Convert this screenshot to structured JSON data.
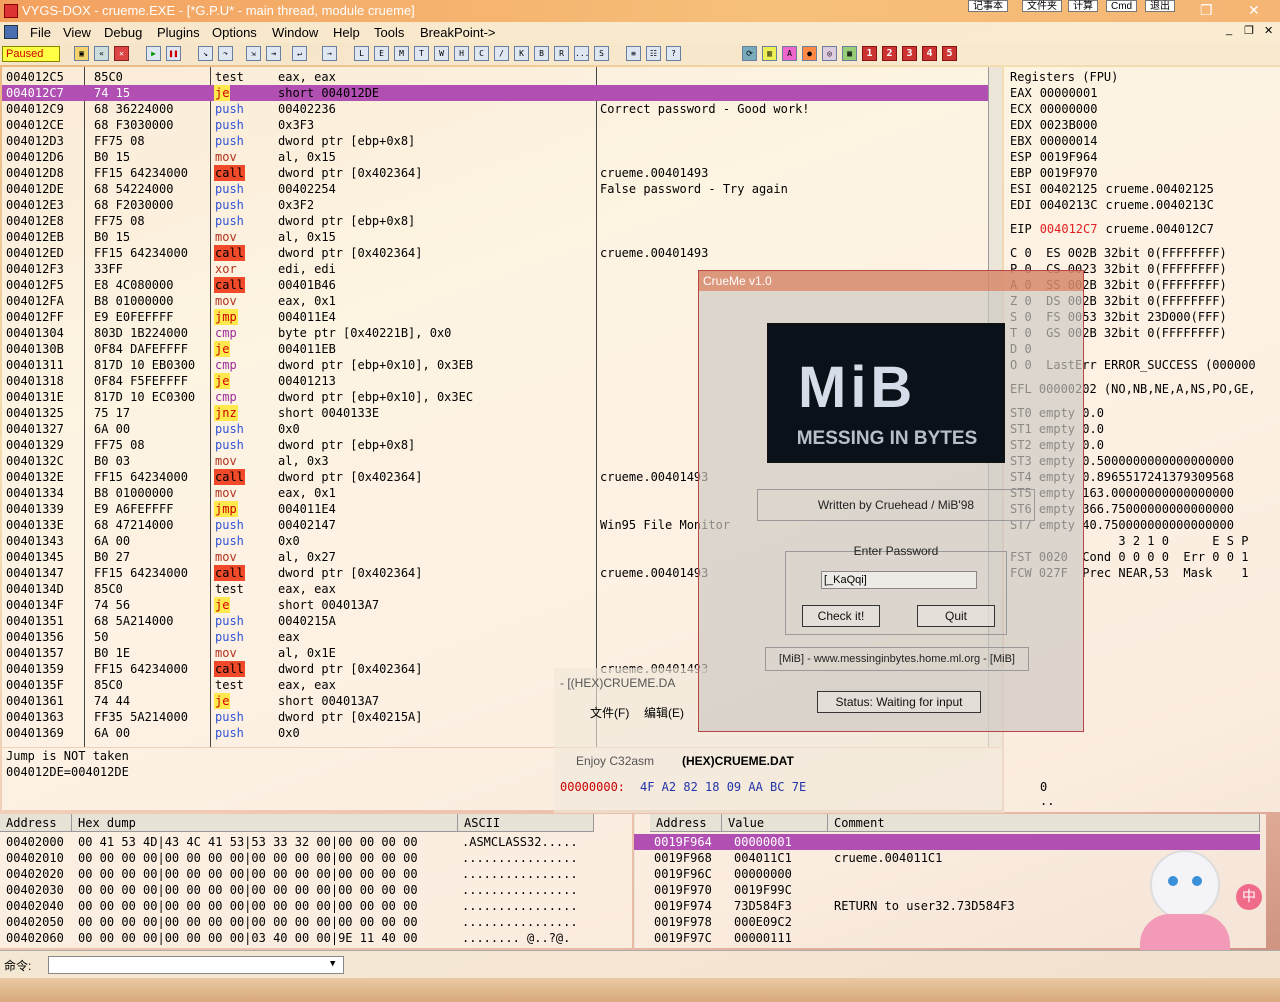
{
  "titlebar": {
    "title": "VYGS-DOX - crueme.EXE - [*G.P.U* - main thread, module crueme]",
    "tray_buttons": [
      "记事本",
      "文件夹",
      "计算",
      "Cmd",
      "退出"
    ]
  },
  "menu": [
    "File",
    "View",
    "Debug",
    "Plugins",
    "Options",
    "Window",
    "Help",
    "Tools",
    "BreakPoint->"
  ],
  "toolbar": {
    "status": "Paused",
    "letter_buttons": [
      "L",
      "E",
      "M",
      "T",
      "W",
      "H",
      "C",
      "/",
      "K",
      "B",
      "R",
      "...",
      "S"
    ],
    "numbers": [
      "1",
      "2",
      "3",
      "4",
      "5"
    ]
  },
  "disasm": [
    {
      "addr": "004012C5",
      "hex": "85C0",
      "mn": "test",
      "op": "eax, eax",
      "cmt": "",
      "cls": "opnd"
    },
    {
      "addr": "004012C7",
      "hex": "74 15",
      "mn": "je",
      "op": "short 004012DE",
      "cmt": "",
      "cls": "jmp",
      "hl": true
    },
    {
      "addr": "004012C9",
      "hex": "68 36224000",
      "mn": "push",
      "op": "00402236",
      "cmt": "Correct password - Good work!",
      "cls": "push"
    },
    {
      "addr": "004012CE",
      "hex": "68 F3030000",
      "mn": "push",
      "op": "0x3F3",
      "cmt": "",
      "cls": "push"
    },
    {
      "addr": "004012D3",
      "hex": "FF75 08",
      "mn": "push",
      "op": "dword ptr [ebp+0x8]",
      "cmt": "",
      "cls": "push"
    },
    {
      "addr": "004012D6",
      "hex": "B0 15",
      "mn": "mov",
      "op": "al, 0x15",
      "cmt": "",
      "cls": "mov"
    },
    {
      "addr": "004012D8",
      "hex": "FF15 64234000",
      "mn": "call",
      "op": "dword ptr [0x402364]",
      "cmt": "crueme.00401493",
      "cls": "call"
    },
    {
      "addr": "004012DE",
      "hex": "68 54224000",
      "mn": "push",
      "op": "00402254",
      "cmt": "False password - Try again",
      "cls": "push"
    },
    {
      "addr": "004012E3",
      "hex": "68 F2030000",
      "mn": "push",
      "op": "0x3F2",
      "cmt": "",
      "cls": "push"
    },
    {
      "addr": "004012E8",
      "hex": "FF75 08",
      "mn": "push",
      "op": "dword ptr [ebp+0x8]",
      "cmt": "",
      "cls": "push"
    },
    {
      "addr": "004012EB",
      "hex": "B0 15",
      "mn": "mov",
      "op": "al, 0x15",
      "cmt": "",
      "cls": "mov"
    },
    {
      "addr": "004012ED",
      "hex": "FF15 64234000",
      "mn": "call",
      "op": "dword ptr [0x402364]",
      "cmt": "crueme.00401493",
      "cls": "call"
    },
    {
      "addr": "004012F3",
      "hex": "33FF",
      "mn": "xor",
      "op": "edi, edi",
      "cmt": "",
      "cls": "mov"
    },
    {
      "addr": "004012F5",
      "hex": "E8 4C080000",
      "mn": "call",
      "op": "00401B46",
      "cmt": "",
      "cls": "call"
    },
    {
      "addr": "004012FA",
      "hex": "B8 01000000",
      "mn": "mov",
      "op": "eax, 0x1",
      "cmt": "",
      "cls": "mov"
    },
    {
      "addr": "004012FF",
      "hex": "E9 E0FEFFFF",
      "mn": "jmp",
      "op": "004011E4",
      "cmt": "",
      "cls": "jmp"
    },
    {
      "addr": "00401304",
      "hex": "803D 1B224000",
      "mn": "cmp",
      "op": "byte ptr [0x40221B], 0x0",
      "cmt": "",
      "cls": "cmp"
    },
    {
      "addr": "0040130B",
      "hex": "0F84 DAFEFFFF",
      "mn": "je",
      "op": "004011EB",
      "cmt": "",
      "cls": "jmp"
    },
    {
      "addr": "00401311",
      "hex": "817D 10 EB0300",
      "mn": "cmp",
      "op": "dword ptr [ebp+0x10], 0x3EB",
      "cmt": "",
      "cls": "cmp"
    },
    {
      "addr": "00401318",
      "hex": "0F84 F5FEFFFF",
      "mn": "je",
      "op": "00401213",
      "cmt": "",
      "cls": "jmp"
    },
    {
      "addr": "0040131E",
      "hex": "817D 10 EC0300",
      "mn": "cmp",
      "op": "dword ptr [ebp+0x10], 0x3EC",
      "cmt": "",
      "cls": "cmp"
    },
    {
      "addr": "00401325",
      "hex": "75 17",
      "mn": "jnz",
      "op": "short 0040133E",
      "cmt": "",
      "cls": "jmp"
    },
    {
      "addr": "00401327",
      "hex": "6A 00",
      "mn": "push",
      "op": "0x0",
      "cmt": "",
      "cls": "push"
    },
    {
      "addr": "00401329",
      "hex": "FF75 08",
      "mn": "push",
      "op": "dword ptr [ebp+0x8]",
      "cmt": "",
      "cls": "push"
    },
    {
      "addr": "0040132C",
      "hex": "B0 03",
      "mn": "mov",
      "op": "al, 0x3",
      "cmt": "",
      "cls": "mov"
    },
    {
      "addr": "0040132E",
      "hex": "FF15 64234000",
      "mn": "call",
      "op": "dword ptr [0x402364]",
      "cmt": "crueme.00401493",
      "cls": "call"
    },
    {
      "addr": "00401334",
      "hex": "B8 01000000",
      "mn": "mov",
      "op": "eax, 0x1",
      "cmt": "",
      "cls": "mov"
    },
    {
      "addr": "00401339",
      "hex": "E9 A6FEFFFF",
      "mn": "jmp",
      "op": "004011E4",
      "cmt": "",
      "cls": "jmp"
    },
    {
      "addr": "0040133E",
      "hex": "68 47214000",
      "mn": "push",
      "op": "00402147",
      "cmt": "Win95 File Monitor",
      "cls": "push"
    },
    {
      "addr": "00401343",
      "hex": "6A 00",
      "mn": "push",
      "op": "0x0",
      "cmt": "",
      "cls": "push"
    },
    {
      "addr": "00401345",
      "hex": "B0 27",
      "mn": "mov",
      "op": "al, 0x27",
      "cmt": "",
      "cls": "mov"
    },
    {
      "addr": "00401347",
      "hex": "FF15 64234000",
      "mn": "call",
      "op": "dword ptr [0x402364]",
      "cmt": "crueme.00401493",
      "cls": "call"
    },
    {
      "addr": "0040134D",
      "hex": "85C0",
      "mn": "test",
      "op": "eax, eax",
      "cmt": "",
      "cls": "opnd"
    },
    {
      "addr": "0040134F",
      "hex": "74 56",
      "mn": "je",
      "op": "short 004013A7",
      "cmt": "",
      "cls": "jmp"
    },
    {
      "addr": "00401351",
      "hex": "68 5A214000",
      "mn": "push",
      "op": "0040215A",
      "cmt": "",
      "cls": "push"
    },
    {
      "addr": "00401356",
      "hex": "50",
      "mn": "push",
      "op": "eax",
      "cmt": "",
      "cls": "push"
    },
    {
      "addr": "00401357",
      "hex": "B0 1E",
      "mn": "mov",
      "op": "al, 0x1E",
      "cmt": "",
      "cls": "mov"
    },
    {
      "addr": "00401359",
      "hex": "FF15 64234000",
      "mn": "call",
      "op": "dword ptr [0x402364]",
      "cmt": "crueme.00401493",
      "cls": "call"
    },
    {
      "addr": "0040135F",
      "hex": "85C0",
      "mn": "test",
      "op": "eax, eax",
      "cmt": "",
      "cls": "opnd"
    },
    {
      "addr": "00401361",
      "hex": "74 44",
      "mn": "je",
      "op": "short 004013A7",
      "cmt": "",
      "cls": "jmp"
    },
    {
      "addr": "00401363",
      "hex": "FF35 5A214000",
      "mn": "push",
      "op": "dword ptr [0x40215A]",
      "cmt": "",
      "cls": "push"
    },
    {
      "addr": "00401369",
      "hex": "6A 00",
      "mn": "push",
      "op": "0x0",
      "cmt": "",
      "cls": "push"
    }
  ],
  "info": {
    "line1": "Jump is NOT taken",
    "line2": "004012DE=004012DE"
  },
  "registers": {
    "title": "Registers (FPU)",
    "gp": [
      {
        "n": "EAX",
        "v": "00000001",
        "x": ""
      },
      {
        "n": "ECX",
        "v": "00000000",
        "x": ""
      },
      {
        "n": "EDX",
        "v": "0023B000",
        "x": ""
      },
      {
        "n": "EBX",
        "v": "00000014",
        "x": ""
      },
      {
        "n": "ESP",
        "v": "0019F964",
        "x": ""
      },
      {
        "n": "EBP",
        "v": "0019F970",
        "x": ""
      },
      {
        "n": "ESI",
        "v": "00402125",
        "x": "crueme.00402125"
      },
      {
        "n": "EDI",
        "v": "0040213C",
        "x": "crueme.0040213C"
      }
    ],
    "eip": {
      "n": "EIP",
      "v": "004012C7",
      "x": "crueme.004012C7"
    },
    "flags": [
      "C 0  ES 002B 32bit 0(FFFFFFFF)",
      "P 0  CS 0023 32bit 0(FFFFFFFF)",
      "A 0  SS 002B 32bit 0(FFFFFFFF)",
      "Z 0  DS 002B 32bit 0(FFFFFFFF)",
      "S 0  FS 0053 32bit 23D000(FFF)",
      "T 0  GS 002B 32bit 0(FFFFFFFF)",
      "D 0",
      "O 0  LastErr ERROR_SUCCESS (000000"
    ],
    "efl": "EFL 00000202 (NO,NB,NE,A,NS,PO,GE,",
    "st": [
      "ST0 empty 0.0",
      "ST1 empty 0.0",
      "ST2 empty 0.0",
      "ST3 empty 0.5000000000000000000",
      "ST4 empty 0.8965517241379309568",
      "ST5 empty 163.00000000000000000",
      "ST6 empty 366.75000000000000000",
      "ST7 empty 40.750000000000000000"
    ],
    "fpu_hdr": "               3 2 1 0      E S P",
    "fst": "FST 0020  Cond 0 0 0 0  Err 0 0 1",
    "fcw": "FCW 027F  Prec NEAR,53  Mask    1"
  },
  "dump": {
    "headers": [
      "Address",
      "Hex dump",
      "ASCII"
    ],
    "rows": [
      {
        "a": "00402000",
        "h": "00 41 53 4D|43 4C 41 53|53 33 32 00|00 00 00 00",
        "s": ".ASMCLASS32....."
      },
      {
        "a": "00402010",
        "h": "00 00 00 00|00 00 00 00|00 00 00 00|00 00 00 00",
        "s": "................"
      },
      {
        "a": "00402020",
        "h": "00 00 00 00|00 00 00 00|00 00 00 00|00 00 00 00",
        "s": "................"
      },
      {
        "a": "00402030",
        "h": "00 00 00 00|00 00 00 00|00 00 00 00|00 00 00 00",
        "s": "................"
      },
      {
        "a": "00402040",
        "h": "00 00 00 00|00 00 00 00|00 00 00 00|00 00 00 00",
        "s": "................"
      },
      {
        "a": "00402050",
        "h": "00 00 00 00|00 00 00 00|00 00 00 00|00 00 00 00",
        "s": "................"
      },
      {
        "a": "00402060",
        "h": "00 00 00 00|00 00 00 00|03 40 00 00|9E 11 40 00",
        "s": "........ @..?@."
      }
    ]
  },
  "stack": {
    "headers": [
      "Address",
      "Value",
      "Comment"
    ],
    "rows": [
      {
        "a": "0019F964",
        "v": "00000001",
        "c": "",
        "hl": true
      },
      {
        "a": "0019F968",
        "v": "004011C1",
        "c": "crueme.004011C1"
      },
      {
        "a": "0019F96C",
        "v": "00000000",
        "c": ""
      },
      {
        "a": "0019F970",
        "v": "0019F99C",
        "c": ""
      },
      {
        "a": "0019F974",
        "v": "73D584F3",
        "c": "RETURN to user32.73D584F3"
      },
      {
        "a": "0019F978",
        "v": "000E09C2",
        "c": ""
      },
      {
        "a": "0019F97C",
        "v": "00000111",
        "c": ""
      }
    ]
  },
  "command": {
    "label": "命令:"
  },
  "crueme": {
    "title": "CrueMe v1.0",
    "logo_big": "MiB",
    "logo_small": "MESSING IN BYTES",
    "author": "Written by Cruehead / MiB'98",
    "group": "Enter Password",
    "password": "[_KaQqi]",
    "check": "Check it!",
    "quit": "Quit",
    "url": "[MiB] - www.messinginbytes.home.ml.org - [MiB]",
    "status": "Status: Waiting for input"
  },
  "c32asm": {
    "title": "- [(HEX)CRUEME.DA",
    "menu": [
      "文件(F)",
      "编辑(E)"
    ],
    "tab1": "Enjoy C32asm",
    "tab2": "(HEX)CRUEME.DAT",
    "hex_addr": "00000000:",
    "hex_bytes": "4F A2 82 18 09 AA BC 7E",
    "hex_ascii": "0 .. ~"
  },
  "colors": {
    "highlight": "#b14fb3",
    "call": "#f04a2a",
    "jump": "#ffe94c",
    "push": "#3353d6",
    "mov": "#b2311d",
    "eip": "#e02020"
  },
  "icons": [
    "app-icon",
    "open-icon",
    "restart-icon",
    "close-icon",
    "run-icon",
    "pause-icon",
    "step-into-icon",
    "step-over-icon",
    "trace-into-icon",
    "trace-over-icon",
    "execute-till-return-icon",
    "goto-icon"
  ]
}
